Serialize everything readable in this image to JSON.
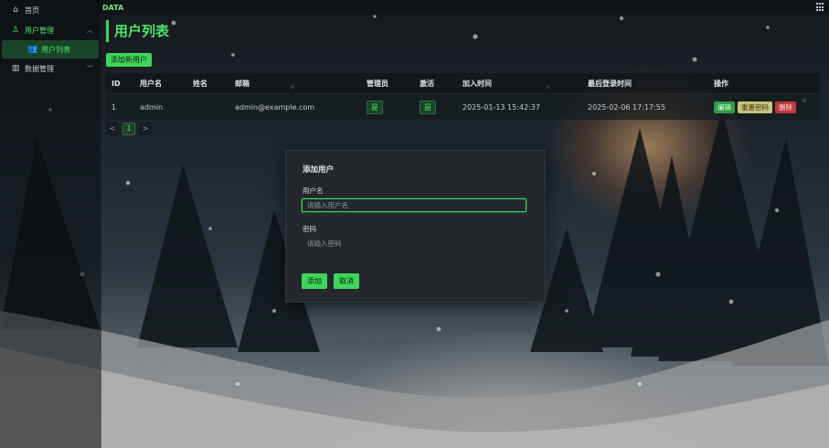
{
  "topbar": {
    "brand": "DATA"
  },
  "sidebar": {
    "home": "首页",
    "user_mgmt": "用户管理",
    "user_list": "用户列表",
    "data_mgmt": "数据管理"
  },
  "main": {
    "title": "用户列表",
    "add_button": "添加新用户",
    "table": {
      "headers": [
        "ID",
        "用户名",
        "姓名",
        "邮箱",
        "管理员",
        "激活",
        "加入时间",
        "最后登录时间",
        "操作"
      ],
      "rows": [
        {
          "id": "1",
          "username": "admin",
          "name": "",
          "email": "admin@example.com",
          "admin": "是",
          "active": "是",
          "created": "2025-01-13 15:42:37",
          "last_login": "2025-02-06 17:17:55",
          "ops": {
            "edit": "编辑",
            "reset": "重置密码",
            "delete": "删除"
          }
        }
      ]
    },
    "pagination": {
      "prev": "<",
      "current": "1",
      "next": ">"
    }
  },
  "modal": {
    "title": "添加用户",
    "username_label": "用户名",
    "username_placeholder": "请输入用户名",
    "password_label": "密码",
    "password_placeholder": "请输入密码",
    "submit": "添加",
    "cancel": "取消"
  },
  "colors": {
    "accent": "#3fd55a",
    "danger": "#c0393b",
    "warning": "#c9c27a"
  }
}
